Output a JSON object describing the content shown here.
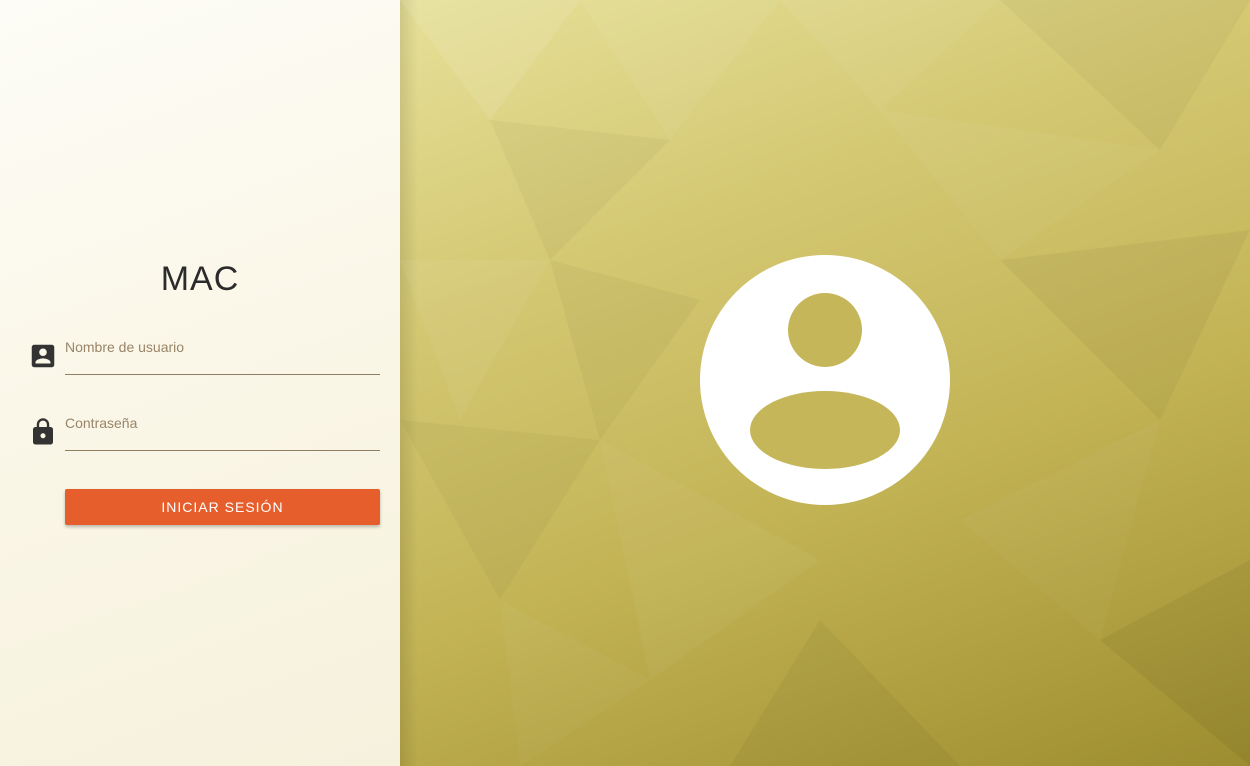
{
  "app": {
    "title": "MAC"
  },
  "login_form": {
    "username": {
      "placeholder": "Nombre de usuario",
      "value": "",
      "icon": "account-box-icon"
    },
    "password": {
      "placeholder": "Contraseña",
      "value": "",
      "icon": "lock-icon"
    },
    "submit_label": "Iniciar sesión"
  },
  "hero": {
    "icon": "account-circle-icon"
  },
  "colors": {
    "accent": "#e55e2b",
    "left_background": "#faf6e6",
    "right_background": "#c3b456",
    "icon": "#333333",
    "avatar": "#ffffff"
  }
}
